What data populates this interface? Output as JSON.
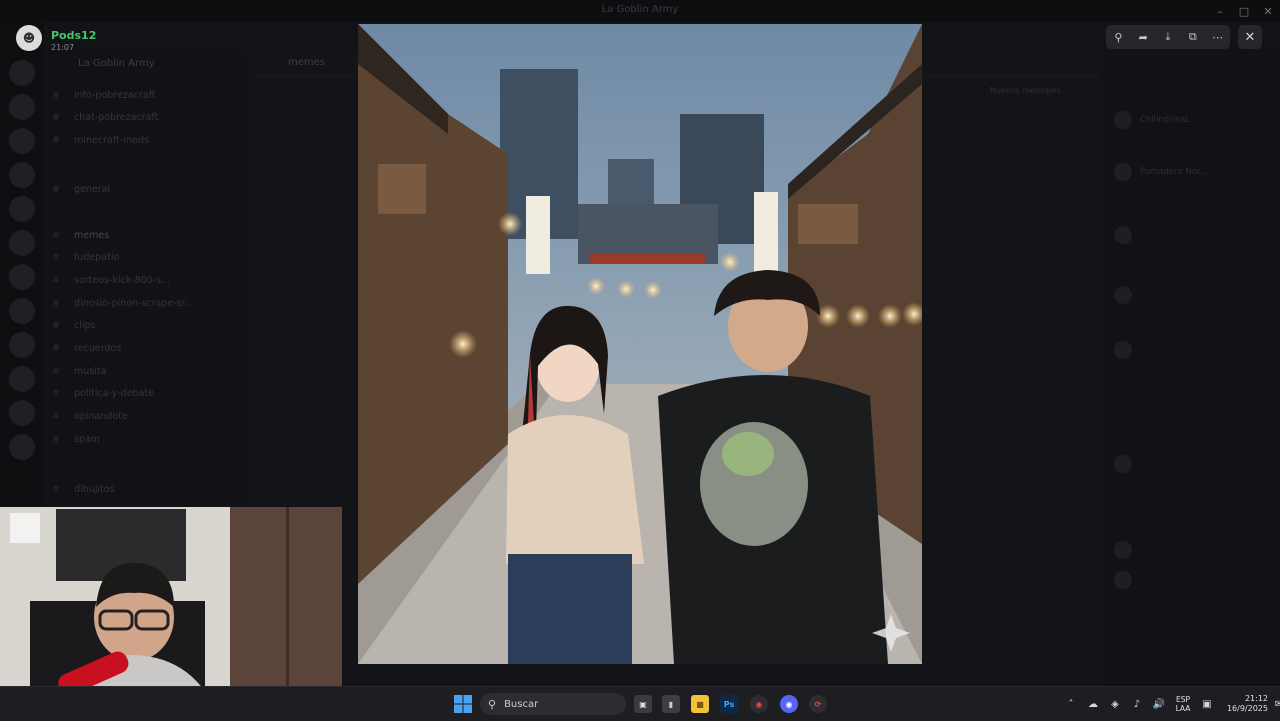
{
  "window": {
    "title": "La Goblin Army"
  },
  "server": {
    "name": "La Goblin Army"
  },
  "channels": [
    {
      "label": "info-pobrezacraft"
    },
    {
      "label": "chat-pobrezacraft"
    },
    {
      "label": "minecraft-mods"
    },
    {
      "label": "general"
    },
    {
      "label": "memes"
    },
    {
      "label": "fudepatio"
    },
    {
      "label": "sorteos-kick-800-s..."
    },
    {
      "label": "dinosio-pinon-scrape-sr..."
    },
    {
      "label": "clips"
    },
    {
      "label": "recuerdos"
    },
    {
      "label": "musita"
    },
    {
      "label": "politica-y-debate"
    },
    {
      "label": "opinandote"
    },
    {
      "label": "spam"
    },
    {
      "label": "dibujitos"
    }
  ],
  "chat": {
    "header": "memes",
    "banner_right": "Nuevos mensajes"
  },
  "members": [
    {
      "name": "ChilindrinaL"
    },
    {
      "name": "Pomadero Nor..."
    },
    {
      "name": ""
    },
    {
      "name": ""
    },
    {
      "name": ""
    },
    {
      "name": ""
    },
    {
      "name": ""
    },
    {
      "name": ""
    }
  ],
  "viewer": {
    "uploader_name": "Pods12",
    "uploader_time": "21:07",
    "tools": [
      "zoom-in",
      "forward",
      "download",
      "open-external",
      "more"
    ]
  },
  "taskbar": {
    "search_placeholder": "Buscar",
    "lang_line1": "ESP",
    "lang_line2": "LAA",
    "time": "21:12",
    "date": "16/9/2025"
  },
  "colors": {
    "accent_green": "#46c46e",
    "discord_blurple": "#5865f2",
    "taskbar_bg": "#1e1e22"
  }
}
